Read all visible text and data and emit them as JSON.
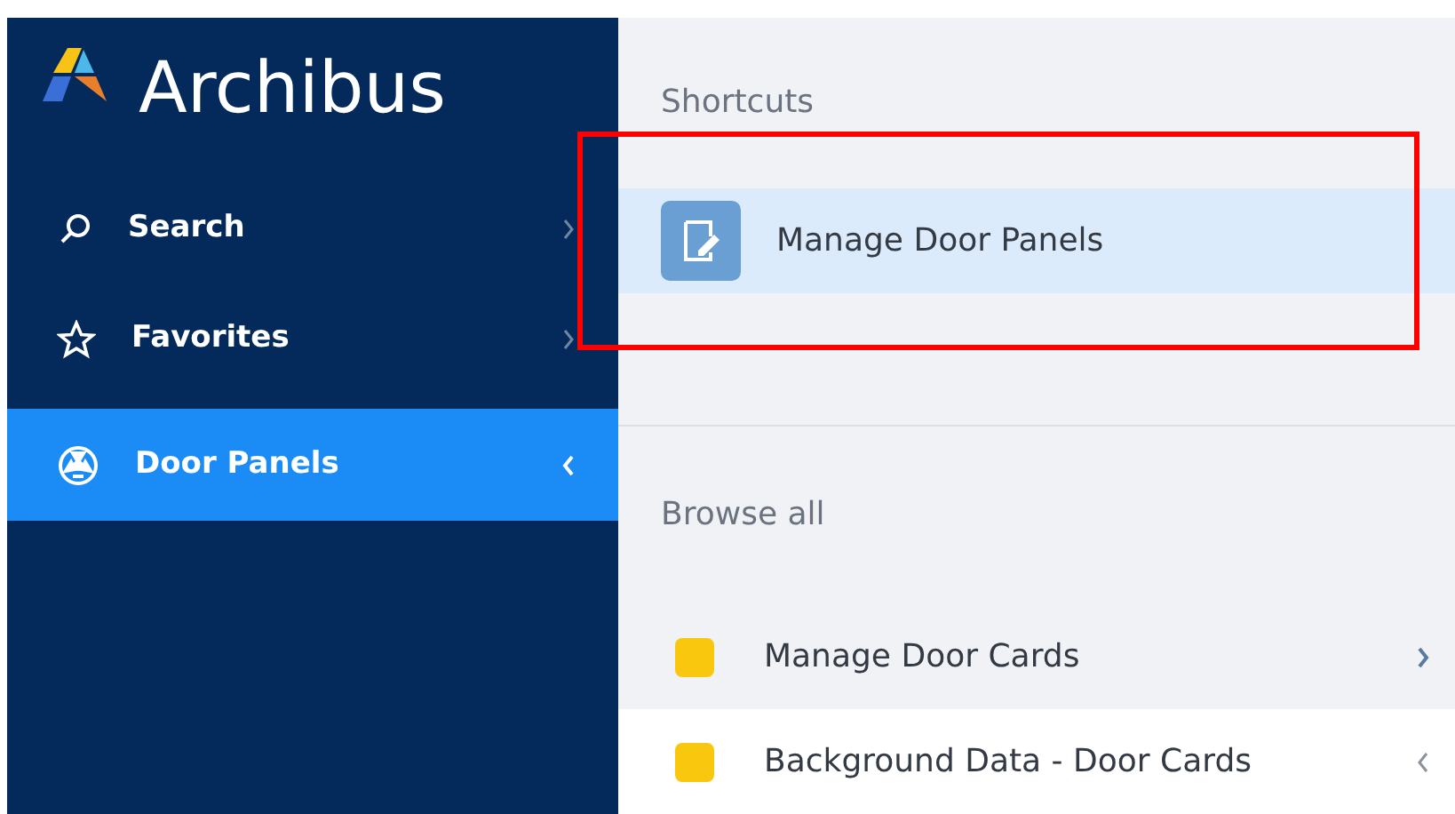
{
  "logo": {
    "text": "Archibus"
  },
  "sidebar": {
    "items": [
      {
        "kind": "search",
        "label": "Search",
        "selected": false,
        "expanded": false
      },
      {
        "kind": "favorites",
        "label": "Favorites",
        "selected": false,
        "expanded": false
      },
      {
        "kind": "app",
        "label": "Door Panels",
        "selected": true,
        "expanded": true
      }
    ]
  },
  "shortcuts": {
    "heading": "Shortcuts",
    "items": [
      {
        "label": "Manage Door Panels",
        "highlighted": true
      }
    ]
  },
  "browse": {
    "heading": "Browse all",
    "items": [
      {
        "label": "Manage Door Cards",
        "expanded": false
      },
      {
        "label": "Background Data - Door Cards",
        "expanded": true
      }
    ]
  }
}
